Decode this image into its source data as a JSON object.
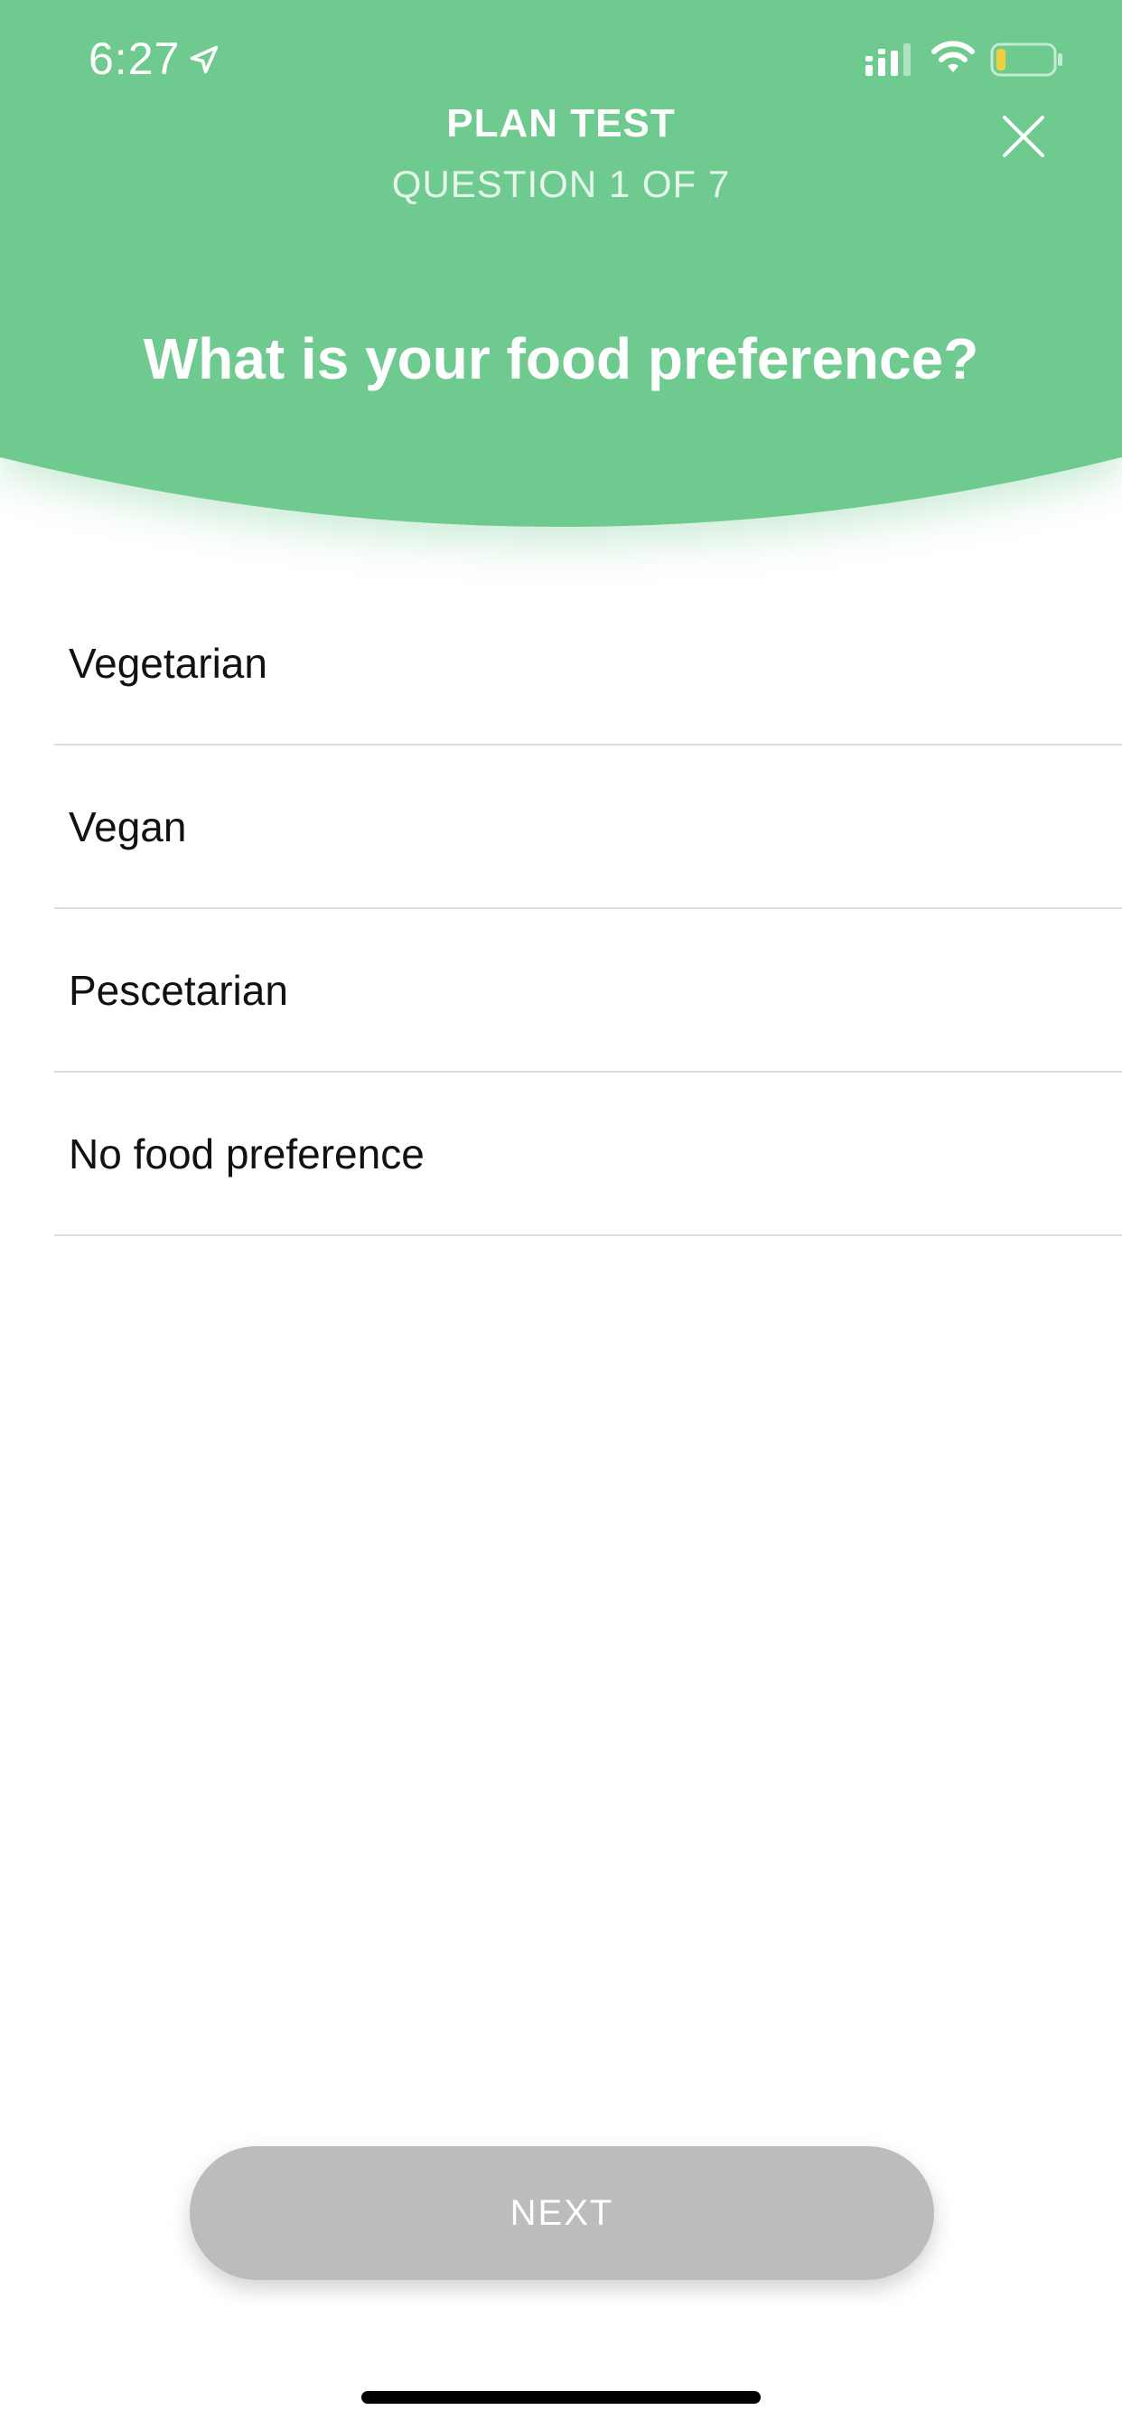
{
  "status_bar": {
    "time": "6:27",
    "icons": [
      "location-arrow-icon",
      "cellular-signal-icon",
      "wifi-icon",
      "battery-icon"
    ]
  },
  "header": {
    "title": "PLAN TEST",
    "subtitle": "QUESTION 1 OF 7",
    "close_icon": "close-icon",
    "background_color": "#6ECA8F"
  },
  "question": "What is your food preference?",
  "options": [
    {
      "label": "Vegetarian"
    },
    {
      "label": "Vegan"
    },
    {
      "label": "Pescetarian"
    },
    {
      "label": "No food preference"
    }
  ],
  "next_button": {
    "label": "NEXT",
    "state": "disabled",
    "color": "#BCBCBC"
  }
}
